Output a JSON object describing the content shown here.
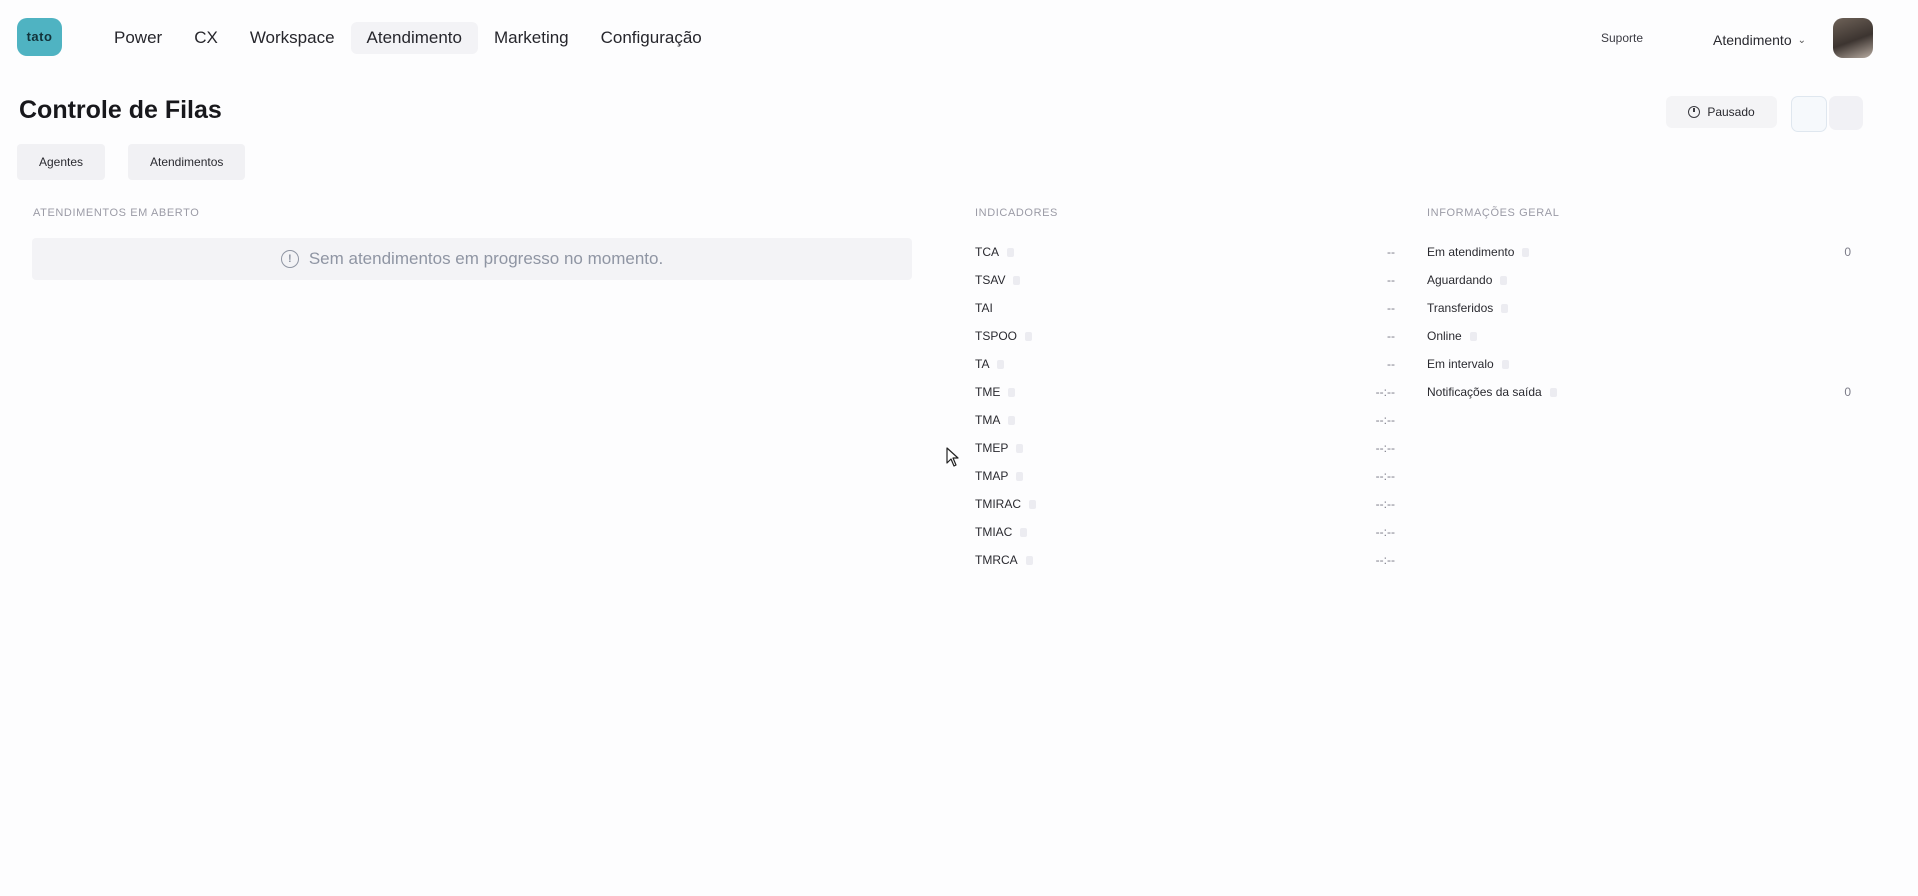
{
  "logo": {
    "line1": "tato",
    "line2": ""
  },
  "nav": {
    "items": [
      {
        "label": "Power"
      },
      {
        "label": "CX"
      },
      {
        "label": "Workspace"
      },
      {
        "label": "Atendimento"
      },
      {
        "label": "Marketing"
      },
      {
        "label": "Configuração"
      }
    ],
    "active_index": 3
  },
  "header": {
    "support_label": "Suporte",
    "user_top": "",
    "user_dept": "Atendimento",
    "chevron": "⌄"
  },
  "page": {
    "title": "Controle de Filas",
    "paused_label": "Pausado"
  },
  "tabs": [
    {
      "label": "Agentes"
    },
    {
      "label": "Atendimentos"
    }
  ],
  "sections": {
    "left_title": "ATENDIMENTOS EM ABERTO",
    "empty_text": "Sem atendimentos em progresso no momento.",
    "indicators_title": "INDICADORES",
    "general_title": "INFORMAÇÕES GERAL"
  },
  "indicators": [
    {
      "label": "TCA",
      "value": "--"
    },
    {
      "label": "TSAV",
      "value": "--"
    },
    {
      "label": "TAI",
      "value": "--"
    },
    {
      "label": "TSPOO",
      "value": "--"
    },
    {
      "label": "TA",
      "value": "--"
    },
    {
      "label": "TME",
      "value": "--:--"
    },
    {
      "label": "TMA",
      "value": "--:--"
    },
    {
      "label": "TMEP",
      "value": "--:--"
    },
    {
      "label": "TMAP",
      "value": "--:--"
    },
    {
      "label": "TMIRAC",
      "value": "--:--"
    },
    {
      "label": "TMIAC",
      "value": "--:--"
    },
    {
      "label": "TMRCA",
      "value": "--:--"
    }
  ],
  "general": [
    {
      "label": "Em atendimento",
      "value": "0"
    },
    {
      "label": "Aguardando",
      "value": ""
    },
    {
      "label": "Transferidos",
      "value": ""
    },
    {
      "label": "Online",
      "value": ""
    },
    {
      "label": "Em intervalo",
      "value": ""
    },
    {
      "label": "Notificações da saída",
      "value": "0"
    }
  ],
  "icons": {
    "paused": "clock-icon",
    "empty_state": "info-icon",
    "user_menu": "chevron-down-icon"
  },
  "colors": {
    "logo_bg": "#4fb3c2",
    "nav_active_bg": "#f3f3f6",
    "muted_text": "#9b9ba6"
  }
}
